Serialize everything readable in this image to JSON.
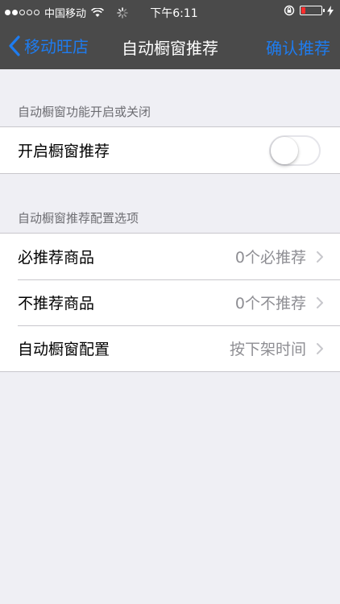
{
  "status_bar": {
    "carrier": "中国移动",
    "time": "下午6:11",
    "signal_filled": 2,
    "signal_total": 5,
    "battery_level": 0.2,
    "battery_color": "#ff2d2d"
  },
  "nav": {
    "back_label": "移动旺店",
    "title": "自动橱窗推荐",
    "confirm_label": "确认推荐"
  },
  "section1": {
    "header": "自动橱窗功能开启或关闭",
    "toggle_label": "开启橱窗推荐",
    "toggle_on": false
  },
  "section2": {
    "header": "自动橱窗推荐配置选项",
    "rows": [
      {
        "label": "必推荐商品",
        "value": "0个必推荐"
      },
      {
        "label": "不推荐商品",
        "value": "0个不推荐"
      },
      {
        "label": "自动橱窗配置",
        "value": "按下架时间"
      }
    ]
  },
  "colors": {
    "accent": "#1e7cf0",
    "nav_background": "#4a4a4a",
    "page_background": "#efeff4"
  },
  "icons": {
    "back": "chevron-left-icon",
    "disclosure": "chevron-right-icon",
    "wifi": "wifi-icon",
    "loading": "activity-spinner-icon",
    "rotation_lock": "rotation-lock-icon",
    "battery": "battery-icon",
    "charging": "bolt-icon"
  }
}
